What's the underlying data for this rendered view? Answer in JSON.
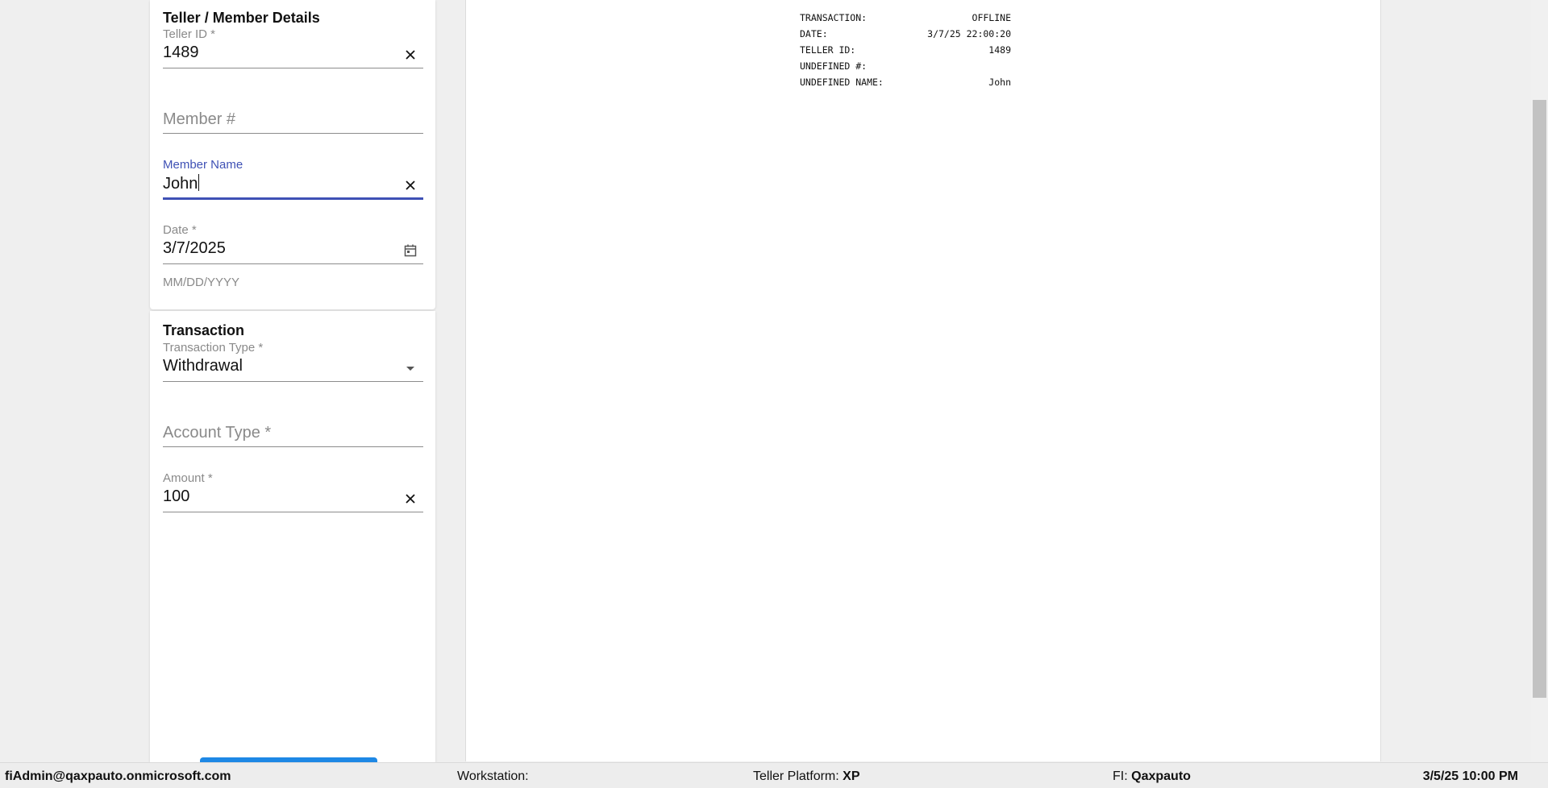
{
  "teller_section": {
    "title": "Teller / Member Details",
    "teller_id": {
      "label": "Teller ID *",
      "value": "1489"
    },
    "member_number": {
      "placeholder": "Member #"
    },
    "member_name": {
      "label": "Member Name",
      "value": "John"
    },
    "date": {
      "label": "Date *",
      "value": "3/7/2025",
      "helper": "MM/DD/YYYY"
    }
  },
  "transaction_section": {
    "title": "Transaction",
    "transaction_type": {
      "label": "Transaction Type *",
      "value": "Withdrawal"
    },
    "account_type": {
      "placeholder": "Account Type *"
    },
    "amount": {
      "label": "Amount *",
      "value": "100"
    }
  },
  "receipt": {
    "lines": [
      {
        "label": "TRANSACTION:",
        "value": "OFFLINE"
      },
      {
        "label": "DATE:",
        "value": "3/7/25 22:00:20"
      },
      {
        "label": "TELLER ID:",
        "value": "1489"
      },
      {
        "label": "UNDEFINED #:",
        "value": ""
      },
      {
        "label": "UNDEFINED NAME:",
        "value": "John"
      }
    ]
  },
  "statusbar": {
    "user": "fiAdmin@qaxpauto.onmicrosoft.com",
    "workstation_label": "Workstation:",
    "workstation_value": "",
    "platform_label": "Teller Platform:",
    "platform_value": "XP",
    "fi_label": "FI:",
    "fi_value": "Qaxpauto",
    "datetime": "3/5/25 10:00 PM"
  },
  "icons": {
    "clear": "close-icon",
    "calendar": "calendar-icon",
    "dropdown": "dropdown-arrow-icon"
  },
  "colors": {
    "focus": "#3f51b5",
    "button": "#1e88e5"
  }
}
